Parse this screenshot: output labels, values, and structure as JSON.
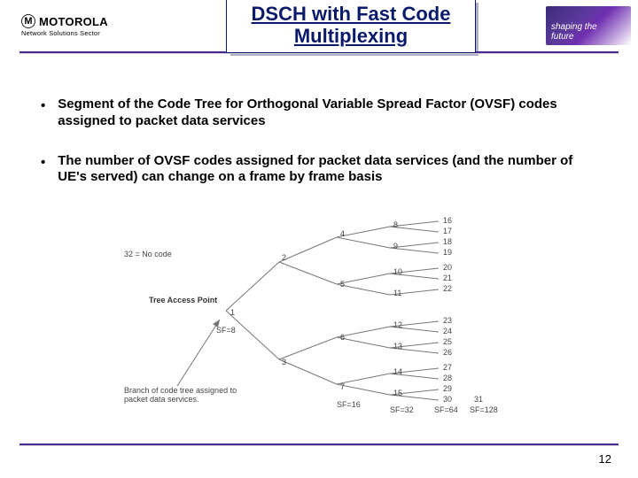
{
  "header": {
    "logo_word": "MOTOROLA",
    "logo_glyph": "M",
    "sector": "Network Solutions Sector",
    "title_line1": "DSCH with Fast Code",
    "title_line2": "Multiplexing",
    "badge_line1": "shaping the",
    "badge_line2": "future"
  },
  "bullets": [
    "Segment of the Code Tree for Orthogonal Variable Spread Factor (OVSF) codes assigned to packet data services",
    "The number of OVSF codes assigned for packet data services (and the number of UE's served) can change on a frame by frame basis"
  ],
  "diagram": {
    "no_code": "32 = No code",
    "tree_access": "Tree Access Point",
    "branch_caption": "Branch of code tree assigned to packet data services.",
    "sf8": "SF=8",
    "sf16": "SF=16",
    "sf32": "SF=32",
    "sf64": "SF=64",
    "sf128": "SF=128",
    "nodes": {
      "n1": "1",
      "n2": "2",
      "n3": "3",
      "n4": "4",
      "n5": "5",
      "n6": "6",
      "n7": "7",
      "n8": "8",
      "n9": "9",
      "n10": "10",
      "n11": "11",
      "n12": "12",
      "n13": "13",
      "n14": "14",
      "n15": "15",
      "r16": "16",
      "r17": "17",
      "r18": "18",
      "r19": "19",
      "r20": "20",
      "r21": "21",
      "r22": "22",
      "r23": "23",
      "r24": "24",
      "r25": "25",
      "r26": "26",
      "r27": "27",
      "r28": "28",
      "r29": "29",
      "r30": "30",
      "r31": "31"
    }
  },
  "page_number": "12"
}
